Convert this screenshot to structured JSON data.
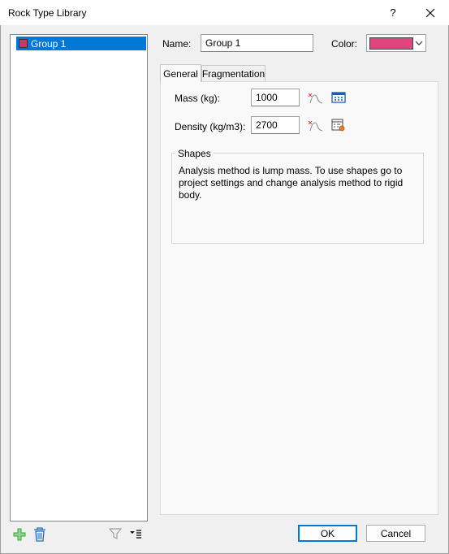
{
  "window": {
    "title": "Rock Type Library",
    "help_label": "?",
    "close_label": "✕"
  },
  "list": {
    "items": [
      {
        "label": "Group 1",
        "color": "#c43b6b"
      }
    ]
  },
  "form": {
    "name_label": "Name:",
    "name_value": "Group 1",
    "color_label": "Color:",
    "color_value": "#e0457b"
  },
  "tabs": [
    {
      "label": "General",
      "active": true
    },
    {
      "label": "Fragmentation",
      "active": false
    }
  ],
  "general": {
    "mass_label": "Mass (kg):",
    "mass_value": "1000",
    "density_label": "Density (kg/m3):",
    "density_value": "2700",
    "shapes": {
      "title": "Shapes",
      "text": "Analysis method is lump mass. To use shapes go to project settings and change analysis method to rigid body."
    }
  },
  "buttons": {
    "ok_label": "OK",
    "cancel_label": "Cancel"
  },
  "colors": {
    "selection": "#0078d7",
    "add_icon": "#3aa63a",
    "delete_icon": "#1e6fc4"
  }
}
